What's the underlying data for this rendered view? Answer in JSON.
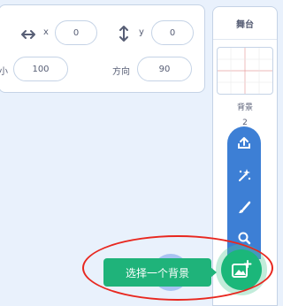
{
  "sprite_info": {
    "x_label": "x",
    "x_value": "0",
    "y_label": "y",
    "y_value": "0",
    "size_label": "小",
    "size_value": "100",
    "direction_label": "方向",
    "direction_value": "90"
  },
  "stage": {
    "title": "舞台",
    "backdrops_label": "背景",
    "backdrops_count": "2"
  },
  "backdrop_menu": {
    "items": [
      "upload-icon",
      "surprise-icon",
      "paint-icon",
      "search-icon"
    ],
    "main_button_icon": "add-image-icon",
    "tooltip": "选择一个背景"
  },
  "colors": {
    "menu_blue": "#3d7fd5",
    "button_green": "#1bb77a",
    "highlight_red": "#e8271f"
  }
}
